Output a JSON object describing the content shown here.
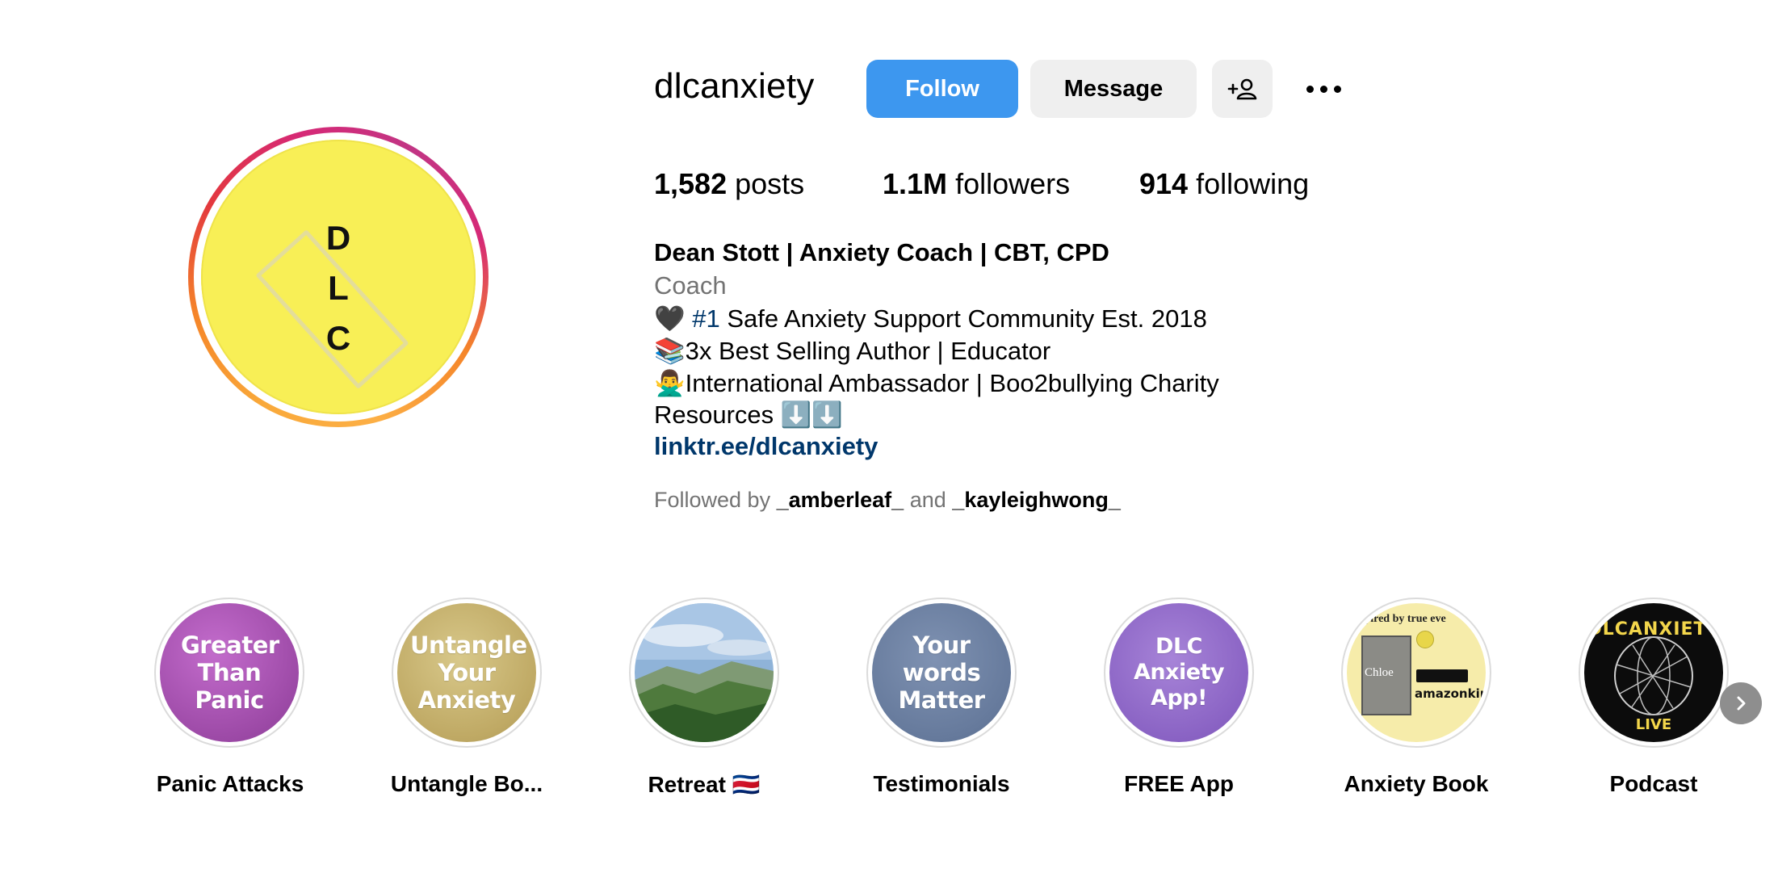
{
  "profile": {
    "username": "dlcanxiety",
    "avatar_letters": [
      "D",
      "L",
      "C"
    ],
    "follow_label": "Follow",
    "message_label": "Message"
  },
  "stats": {
    "posts_count": "1,582",
    "posts_label": "posts",
    "followers_count": "1.1M",
    "followers_label": "followers",
    "following_count": "914",
    "following_label": "following"
  },
  "bio": {
    "name": "Dean Stott | Anxiety Coach | CBT, CPD",
    "category": "Coach",
    "line1_icon": "🖤",
    "line1_hashtag": "#1",
    "line1_text": "Safe Anxiety Support Community Est. 2018",
    "line2": "📚3x Best Selling Author | Educator",
    "line3": "🙅‍♂️International Ambassador | Boo2bullying Charity",
    "line4": "Resources ⬇️⬇️",
    "link": "linktr.ee/dlcanxiety",
    "followed_by_prefix": "Followed by",
    "followed_by_user1": "_amberleaf_",
    "followed_by_and": "and",
    "followed_by_user2": "_kayleighwong_"
  },
  "highlights": [
    {
      "label": "Panic Attacks",
      "cover_text": "Greater Than Panic"
    },
    {
      "label": "Untangle Bo...",
      "cover_text": "Untangle Your Anxiety"
    },
    {
      "label": "Retreat 🇨🇷",
      "cover_text": ""
    },
    {
      "label": "Testimonials",
      "cover_text": "Your words Matter"
    },
    {
      "label": "FREE App",
      "cover_text": "DLC Anxiety App!"
    },
    {
      "label": "Anxiety Book",
      "cover_text": "spired by true eve",
      "book_title": "Chloe",
      "store": "amazonkindle"
    },
    {
      "label": "Podcast",
      "cover_text": "DLCANXIETY",
      "cover_sub": "LIVE"
    }
  ],
  "colors": {
    "follow_button": "#3d97ef",
    "link": "#00376b",
    "avatar_bg": "#f8ef56",
    "secondary_text": "#737373"
  },
  "icons": [
    "add-user-icon",
    "more-options-icon",
    "chevron-right-icon",
    "black-heart-icon"
  ]
}
